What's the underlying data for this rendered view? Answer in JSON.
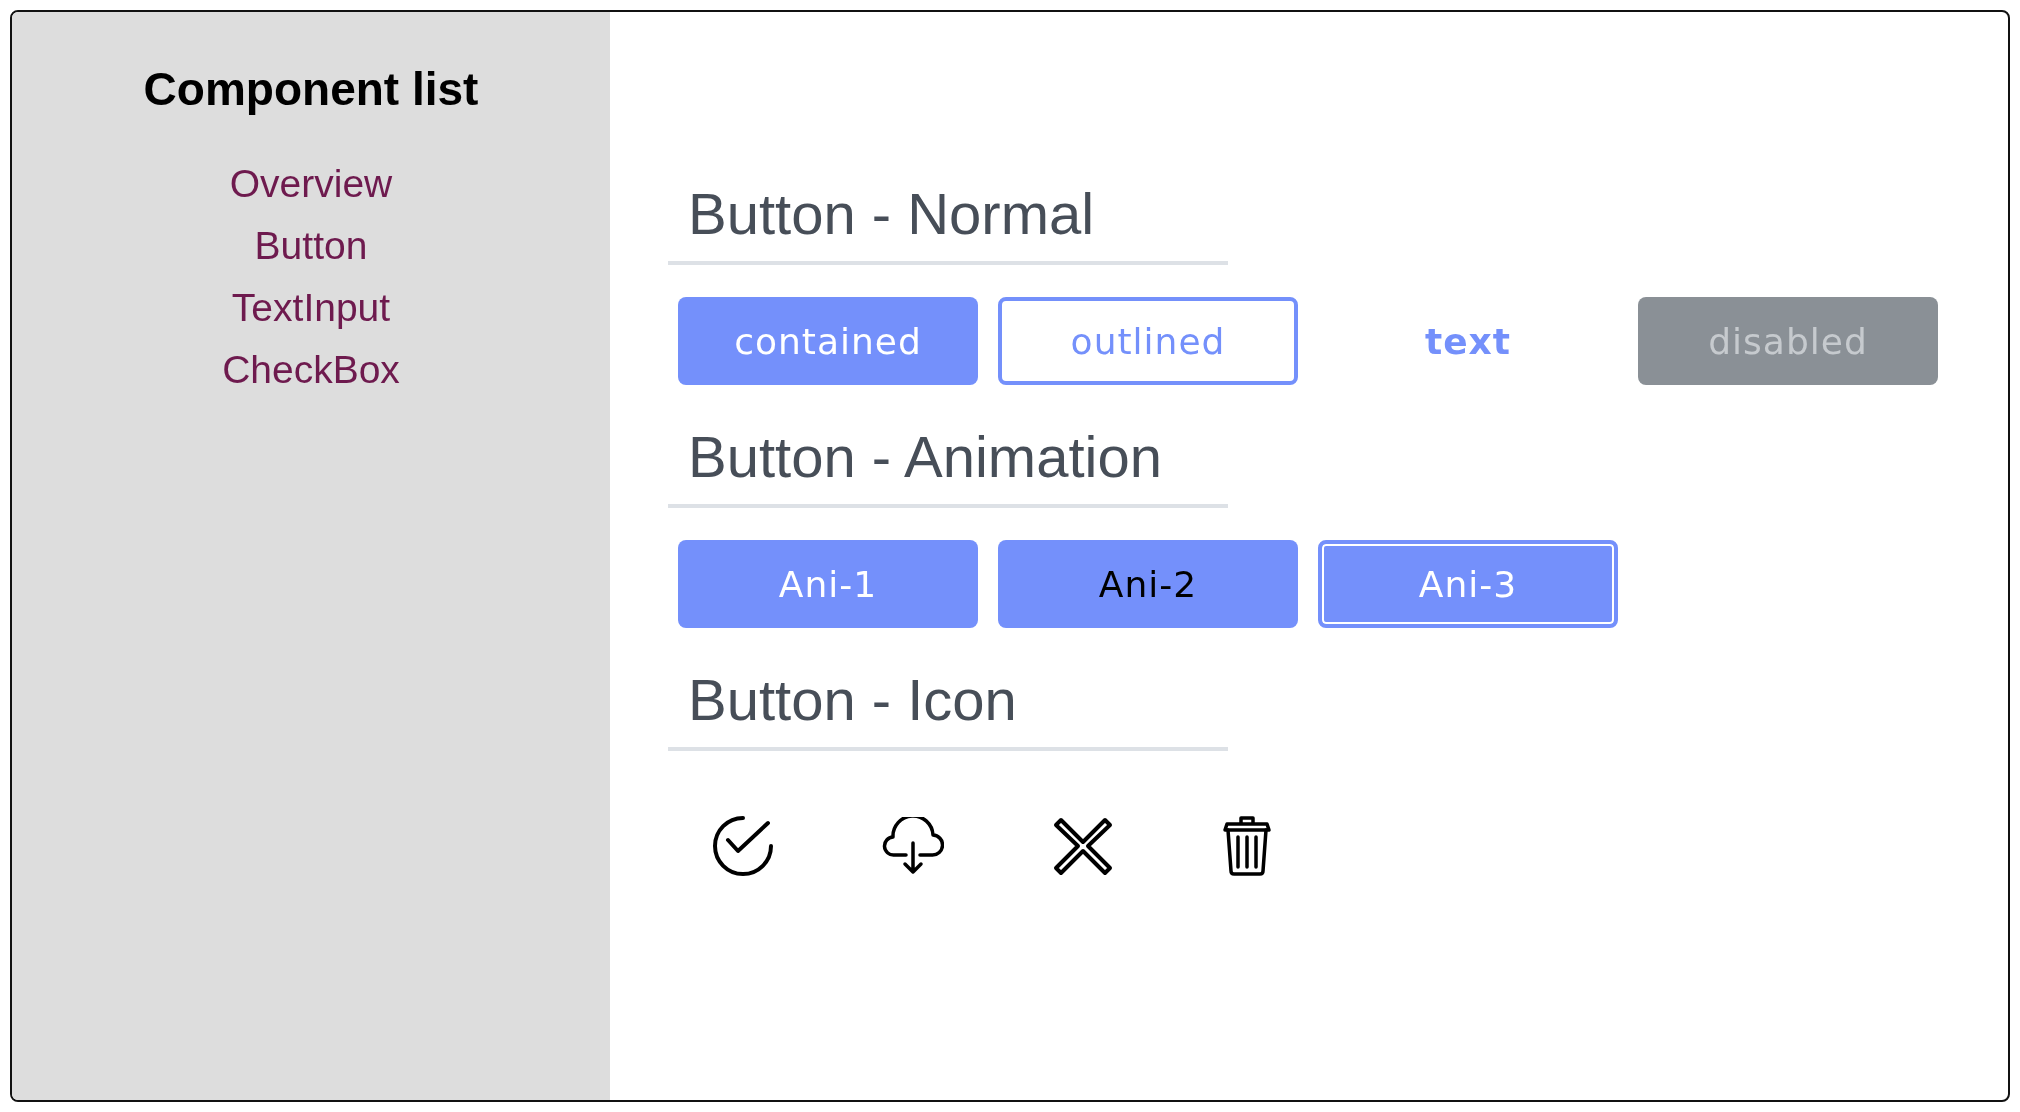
{
  "sidebar": {
    "title": "Component list",
    "items": [
      {
        "label": "Overview"
      },
      {
        "label": "Button"
      },
      {
        "label": "TextInput"
      },
      {
        "label": "CheckBox"
      }
    ]
  },
  "sections": [
    {
      "heading": "Button - Normal",
      "kind": "buttons",
      "buttons": [
        {
          "label": "contained",
          "kind": "contained",
          "disabled": false
        },
        {
          "label": "outlined",
          "kind": "outlined",
          "disabled": false
        },
        {
          "label": "text",
          "kind": "text",
          "disabled": false
        },
        {
          "label": "disabled",
          "kind": "contained",
          "disabled": true
        }
      ]
    },
    {
      "heading": "Button - Animation",
      "kind": "buttons",
      "buttons": [
        {
          "label": "Ani-1",
          "kind": "contained",
          "disabled": false
        },
        {
          "label": "Ani-2",
          "kind": "dark",
          "disabled": false
        },
        {
          "label": "Ani-3",
          "kind": "inset",
          "disabled": false
        }
      ]
    },
    {
      "heading": "Button - Icon",
      "kind": "icons",
      "icons": [
        {
          "kind": "check"
        },
        {
          "kind": "download"
        },
        {
          "kind": "close"
        },
        {
          "kind": "trash"
        }
      ]
    }
  ]
}
